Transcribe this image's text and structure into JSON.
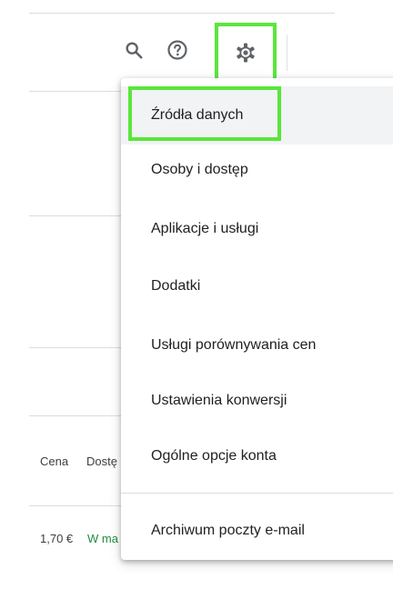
{
  "toolbar": {
    "icons": [
      "search-icon",
      "help-icon",
      "settings-gear-icon"
    ],
    "icon_color": "#5f6368"
  },
  "table": {
    "headers": {
      "price": "Cena",
      "availability": "Dostę"
    },
    "row": {
      "price": "1,70 €",
      "availability": "W ma"
    },
    "availability_color": "#1e8e3e"
  },
  "settings_menu": {
    "items": [
      {
        "label": "Źródła danych",
        "active": true
      },
      {
        "label": "Osoby i dostęp"
      },
      {
        "label": "Aplikacje i usługi"
      },
      {
        "label": "Dodatki"
      },
      {
        "label": "Usługi porównywania cen"
      },
      {
        "label": "Ustawienia konwersji"
      },
      {
        "label": "Ogólne opcje konta"
      },
      {
        "label": "Archiwum poczty e-mail"
      }
    ]
  },
  "highlight_color": "#5ae63c"
}
